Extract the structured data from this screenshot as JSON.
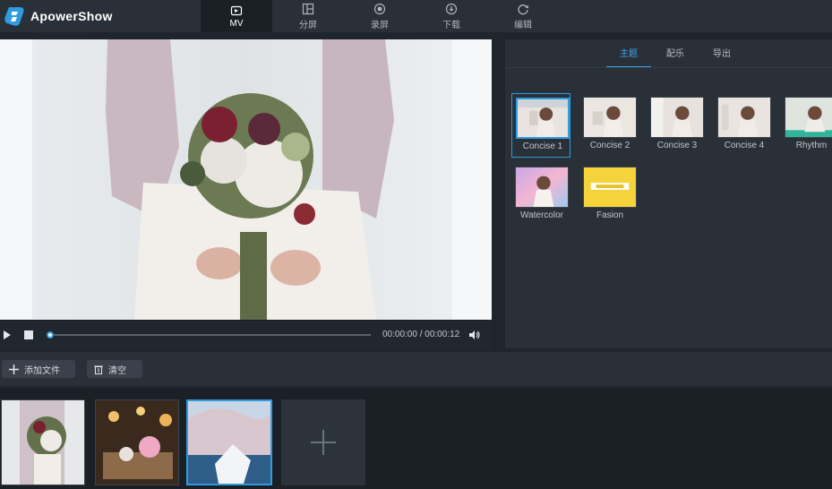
{
  "app": {
    "name": "ApowerShow",
    "accent": "#2f9be0"
  },
  "nav": {
    "tabs": [
      {
        "label": "MV",
        "icon": "mv-icon",
        "active": true
      },
      {
        "label": "分屏",
        "icon": "split-screen-icon",
        "active": false
      },
      {
        "label": "录屏",
        "icon": "record-icon",
        "active": false
      },
      {
        "label": "下载",
        "icon": "download-icon",
        "active": false
      },
      {
        "label": "编辑",
        "icon": "edit-refresh-icon",
        "active": false
      }
    ]
  },
  "player": {
    "time_current": "00:00:00",
    "time_separator": " / ",
    "time_total": "00:00:12",
    "progress": 0.0,
    "play_icon": "play-icon",
    "stop_icon": "stop-icon",
    "volume_icon": "volume-icon"
  },
  "panel": {
    "tabs": [
      {
        "label": "主题",
        "active": true
      },
      {
        "label": "配乐",
        "active": false
      },
      {
        "label": "导出",
        "active": false
      }
    ],
    "themes": [
      {
        "label": "Concise 1",
        "active": true
      },
      {
        "label": "Concise 2",
        "active": false
      },
      {
        "label": "Concise 3",
        "active": false
      },
      {
        "label": "Concise 4",
        "active": false
      },
      {
        "label": "Rhythm",
        "active": false
      },
      {
        "label": "Watercolor",
        "active": false
      },
      {
        "label": "Fasion",
        "active": false
      }
    ]
  },
  "toolbar": {
    "add_label": "添加文件",
    "clear_label": "清空"
  },
  "clips": {
    "count": 3,
    "active_index": 2
  }
}
